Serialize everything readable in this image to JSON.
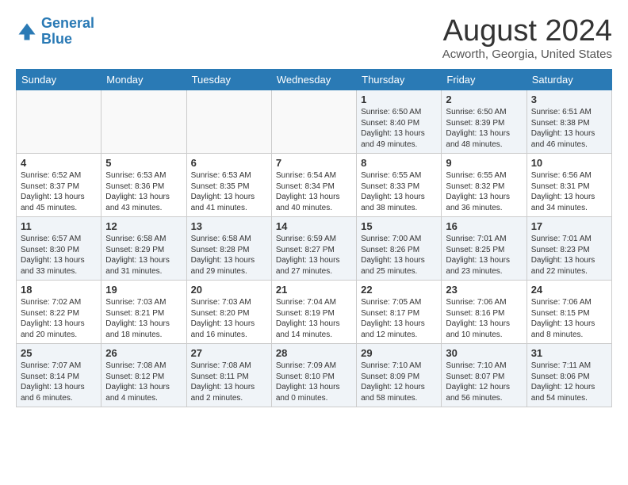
{
  "header": {
    "logo_line1": "General",
    "logo_line2": "Blue",
    "month": "August 2024",
    "location": "Acworth, Georgia, United States"
  },
  "weekdays": [
    "Sunday",
    "Monday",
    "Tuesday",
    "Wednesday",
    "Thursday",
    "Friday",
    "Saturday"
  ],
  "weeks": [
    [
      {
        "day": "",
        "sunrise": "",
        "sunset": "",
        "daylight": ""
      },
      {
        "day": "",
        "sunrise": "",
        "sunset": "",
        "daylight": ""
      },
      {
        "day": "",
        "sunrise": "",
        "sunset": "",
        "daylight": ""
      },
      {
        "day": "",
        "sunrise": "",
        "sunset": "",
        "daylight": ""
      },
      {
        "day": "1",
        "sunrise": "Sunrise: 6:50 AM",
        "sunset": "Sunset: 8:40 PM",
        "daylight": "Daylight: 13 hours and 49 minutes."
      },
      {
        "day": "2",
        "sunrise": "Sunrise: 6:50 AM",
        "sunset": "Sunset: 8:39 PM",
        "daylight": "Daylight: 13 hours and 48 minutes."
      },
      {
        "day": "3",
        "sunrise": "Sunrise: 6:51 AM",
        "sunset": "Sunset: 8:38 PM",
        "daylight": "Daylight: 13 hours and 46 minutes."
      }
    ],
    [
      {
        "day": "4",
        "sunrise": "Sunrise: 6:52 AM",
        "sunset": "Sunset: 8:37 PM",
        "daylight": "Daylight: 13 hours and 45 minutes."
      },
      {
        "day": "5",
        "sunrise": "Sunrise: 6:53 AM",
        "sunset": "Sunset: 8:36 PM",
        "daylight": "Daylight: 13 hours and 43 minutes."
      },
      {
        "day": "6",
        "sunrise": "Sunrise: 6:53 AM",
        "sunset": "Sunset: 8:35 PM",
        "daylight": "Daylight: 13 hours and 41 minutes."
      },
      {
        "day": "7",
        "sunrise": "Sunrise: 6:54 AM",
        "sunset": "Sunset: 8:34 PM",
        "daylight": "Daylight: 13 hours and 40 minutes."
      },
      {
        "day": "8",
        "sunrise": "Sunrise: 6:55 AM",
        "sunset": "Sunset: 8:33 PM",
        "daylight": "Daylight: 13 hours and 38 minutes."
      },
      {
        "day": "9",
        "sunrise": "Sunrise: 6:55 AM",
        "sunset": "Sunset: 8:32 PM",
        "daylight": "Daylight: 13 hours and 36 minutes."
      },
      {
        "day": "10",
        "sunrise": "Sunrise: 6:56 AM",
        "sunset": "Sunset: 8:31 PM",
        "daylight": "Daylight: 13 hours and 34 minutes."
      }
    ],
    [
      {
        "day": "11",
        "sunrise": "Sunrise: 6:57 AM",
        "sunset": "Sunset: 8:30 PM",
        "daylight": "Daylight: 13 hours and 33 minutes."
      },
      {
        "day": "12",
        "sunrise": "Sunrise: 6:58 AM",
        "sunset": "Sunset: 8:29 PM",
        "daylight": "Daylight: 13 hours and 31 minutes."
      },
      {
        "day": "13",
        "sunrise": "Sunrise: 6:58 AM",
        "sunset": "Sunset: 8:28 PM",
        "daylight": "Daylight: 13 hours and 29 minutes."
      },
      {
        "day": "14",
        "sunrise": "Sunrise: 6:59 AM",
        "sunset": "Sunset: 8:27 PM",
        "daylight": "Daylight: 13 hours and 27 minutes."
      },
      {
        "day": "15",
        "sunrise": "Sunrise: 7:00 AM",
        "sunset": "Sunset: 8:26 PM",
        "daylight": "Daylight: 13 hours and 25 minutes."
      },
      {
        "day": "16",
        "sunrise": "Sunrise: 7:01 AM",
        "sunset": "Sunset: 8:25 PM",
        "daylight": "Daylight: 13 hours and 23 minutes."
      },
      {
        "day": "17",
        "sunrise": "Sunrise: 7:01 AM",
        "sunset": "Sunset: 8:23 PM",
        "daylight": "Daylight: 13 hours and 22 minutes."
      }
    ],
    [
      {
        "day": "18",
        "sunrise": "Sunrise: 7:02 AM",
        "sunset": "Sunset: 8:22 PM",
        "daylight": "Daylight: 13 hours and 20 minutes."
      },
      {
        "day": "19",
        "sunrise": "Sunrise: 7:03 AM",
        "sunset": "Sunset: 8:21 PM",
        "daylight": "Daylight: 13 hours and 18 minutes."
      },
      {
        "day": "20",
        "sunrise": "Sunrise: 7:03 AM",
        "sunset": "Sunset: 8:20 PM",
        "daylight": "Daylight: 13 hours and 16 minutes."
      },
      {
        "day": "21",
        "sunrise": "Sunrise: 7:04 AM",
        "sunset": "Sunset: 8:19 PM",
        "daylight": "Daylight: 13 hours and 14 minutes."
      },
      {
        "day": "22",
        "sunrise": "Sunrise: 7:05 AM",
        "sunset": "Sunset: 8:17 PM",
        "daylight": "Daylight: 13 hours and 12 minutes."
      },
      {
        "day": "23",
        "sunrise": "Sunrise: 7:06 AM",
        "sunset": "Sunset: 8:16 PM",
        "daylight": "Daylight: 13 hours and 10 minutes."
      },
      {
        "day": "24",
        "sunrise": "Sunrise: 7:06 AM",
        "sunset": "Sunset: 8:15 PM",
        "daylight": "Daylight: 13 hours and 8 minutes."
      }
    ],
    [
      {
        "day": "25",
        "sunrise": "Sunrise: 7:07 AM",
        "sunset": "Sunset: 8:14 PM",
        "daylight": "Daylight: 13 hours and 6 minutes."
      },
      {
        "day": "26",
        "sunrise": "Sunrise: 7:08 AM",
        "sunset": "Sunset: 8:12 PM",
        "daylight": "Daylight: 13 hours and 4 minutes."
      },
      {
        "day": "27",
        "sunrise": "Sunrise: 7:08 AM",
        "sunset": "Sunset: 8:11 PM",
        "daylight": "Daylight: 13 hours and 2 minutes."
      },
      {
        "day": "28",
        "sunrise": "Sunrise: 7:09 AM",
        "sunset": "Sunset: 8:10 PM",
        "daylight": "Daylight: 13 hours and 0 minutes."
      },
      {
        "day": "29",
        "sunrise": "Sunrise: 7:10 AM",
        "sunset": "Sunset: 8:09 PM",
        "daylight": "Daylight: 12 hours and 58 minutes."
      },
      {
        "day": "30",
        "sunrise": "Sunrise: 7:10 AM",
        "sunset": "Sunset: 8:07 PM",
        "daylight": "Daylight: 12 hours and 56 minutes."
      },
      {
        "day": "31",
        "sunrise": "Sunrise: 7:11 AM",
        "sunset": "Sunset: 8:06 PM",
        "daylight": "Daylight: 12 hours and 54 minutes."
      }
    ]
  ]
}
